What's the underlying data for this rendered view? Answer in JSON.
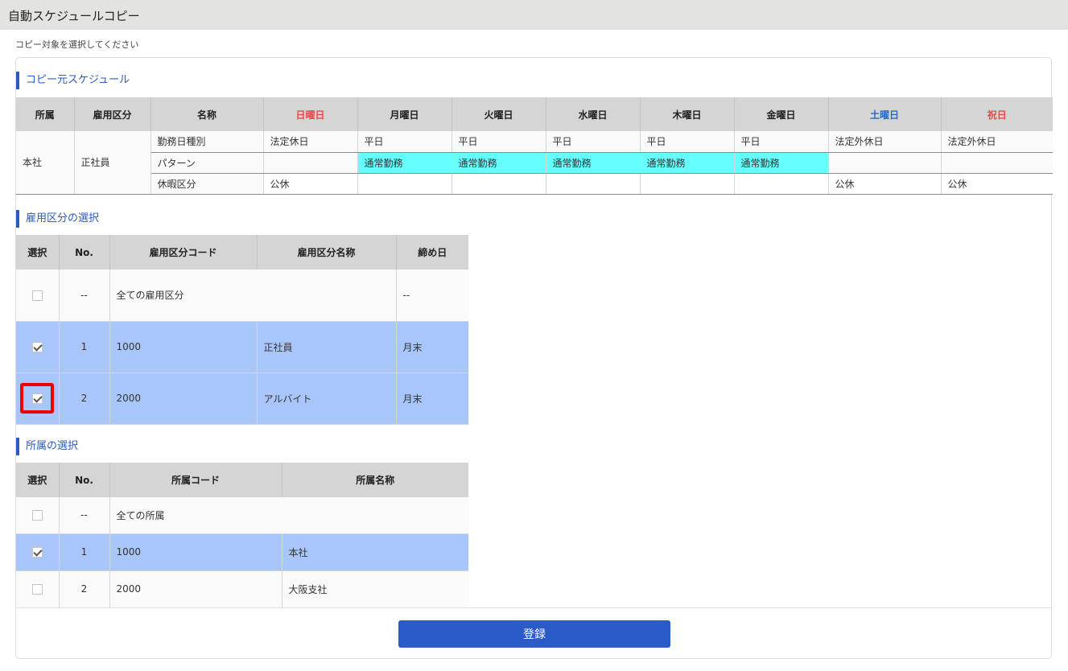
{
  "header": {
    "title": "自動スケジュールコピー"
  },
  "instruction": "コピー対象を選択してください",
  "source_schedule": {
    "title": "コピー元スケジュール",
    "columns": [
      "所属",
      "雇用区分",
      "名称",
      "日曜日",
      "月曜日",
      "火曜日",
      "水曜日",
      "木曜日",
      "金曜日",
      "土曜日",
      "祝日"
    ],
    "dept": "本社",
    "employment": "正社員",
    "rows": [
      {
        "label": "勤務日種別",
        "cells": [
          "法定休日",
          "平日",
          "平日",
          "平日",
          "平日",
          "平日",
          "法定外休日",
          "法定外休日"
        ]
      },
      {
        "label": "パターン",
        "cells": [
          "",
          "通常勤務",
          "通常勤務",
          "通常勤務",
          "通常勤務",
          "通常勤務",
          "",
          ""
        ]
      },
      {
        "label": "休暇区分",
        "cells": [
          "公休",
          "",
          "",
          "",
          "",
          "",
          "公休",
          "公休"
        ]
      }
    ]
  },
  "employment_select": {
    "title": "雇用区分の選択",
    "columns": [
      "選択",
      "No.",
      "雇用区分コード",
      "雇用区分名称",
      "締め日"
    ],
    "all_row": {
      "no": "--",
      "label": "全ての雇用区分",
      "close": "--"
    },
    "rows": [
      {
        "no": "1",
        "code": "1000",
        "name": "正社員",
        "close": "月末",
        "checked": true
      },
      {
        "no": "2",
        "code": "2000",
        "name": "アルバイト",
        "close": "月末",
        "checked": true
      }
    ]
  },
  "dept_select": {
    "title": "所属の選択",
    "columns": [
      "選択",
      "No.",
      "所属コード",
      "所属名称"
    ],
    "all_row": {
      "no": "--",
      "label": "全ての所属"
    },
    "rows": [
      {
        "no": "1",
        "code": "1000",
        "name": "本社",
        "checked": true
      },
      {
        "no": "2",
        "code": "2000",
        "name": "大阪支社",
        "checked": false
      }
    ]
  },
  "footer": {
    "register_label": "登録"
  },
  "colors": {
    "accent": "#2a5bc8",
    "selected_row": "#a9c6fb",
    "pattern_cell": "#66ffff",
    "highlight": "#ee0000"
  }
}
